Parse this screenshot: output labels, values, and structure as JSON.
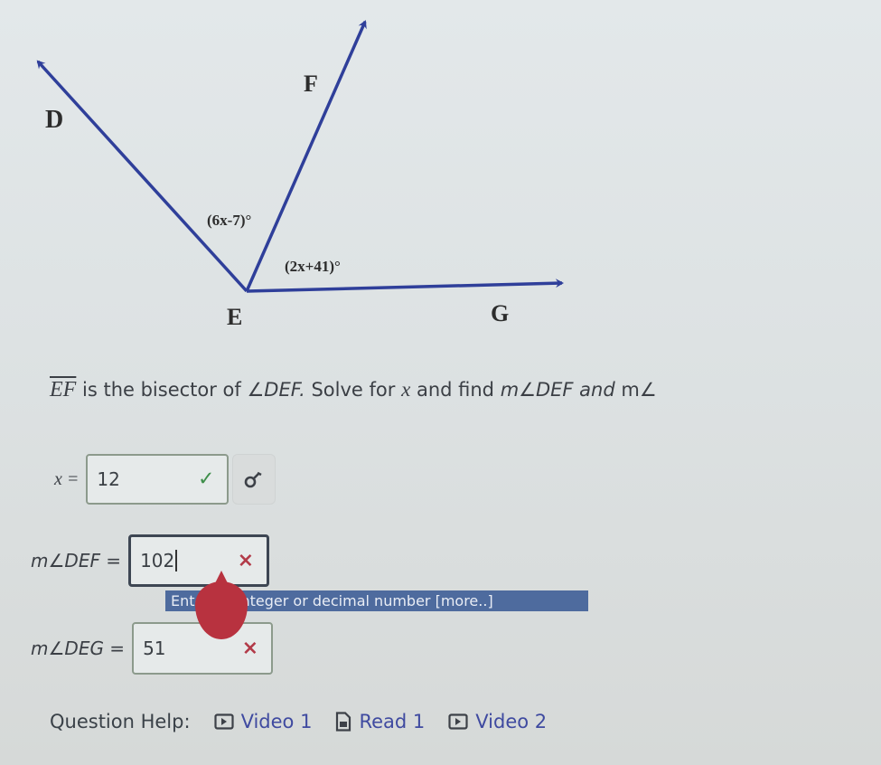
{
  "diagram": {
    "points": {
      "D": "D",
      "E": "E",
      "F": "F",
      "G": "G"
    },
    "angle_labels": {
      "DEF_part": "(6x-7)°",
      "FEG_part": "(2x+41)°"
    },
    "ray_color": "#2f3f9a"
  },
  "question": {
    "segment": "EF",
    "text_1": " is the bisector of ",
    "angle": "∠DEF.",
    "text_2": " Solve for ",
    "variable": "x",
    "text_3": " and find ",
    "find_1": "m∠DEF",
    "text_4": " and ",
    "find_2": "m∠"
  },
  "answers": {
    "x": {
      "label": "x =",
      "value": "12",
      "status": "correct",
      "status_icon": "✓"
    },
    "m_def": {
      "label": "m∠DEF =",
      "value": "102",
      "status": "incorrect",
      "status_icon": "×"
    },
    "m_deg": {
      "label": "m∠DEG =",
      "value": "51",
      "status": "incorrect",
      "status_icon": "×"
    }
  },
  "symbol_button": {
    "icon": "key-icon"
  },
  "tooltip": {
    "text": "Enter an integer or decimal number [more..]",
    "visible_text": "En     n integer or decimal number [more..]"
  },
  "help": {
    "label": "Question Help:",
    "links": [
      {
        "icon": "video-icon",
        "label": "Video 1"
      },
      {
        "icon": "document-icon",
        "label": "Read 1"
      },
      {
        "icon": "video-icon",
        "label": "Video 2"
      }
    ]
  },
  "colors": {
    "correct": "#3e8e4a",
    "incorrect": "#b23a48",
    "link": "#3f4aa0",
    "tooltip_bg": "#4e6b9e"
  }
}
